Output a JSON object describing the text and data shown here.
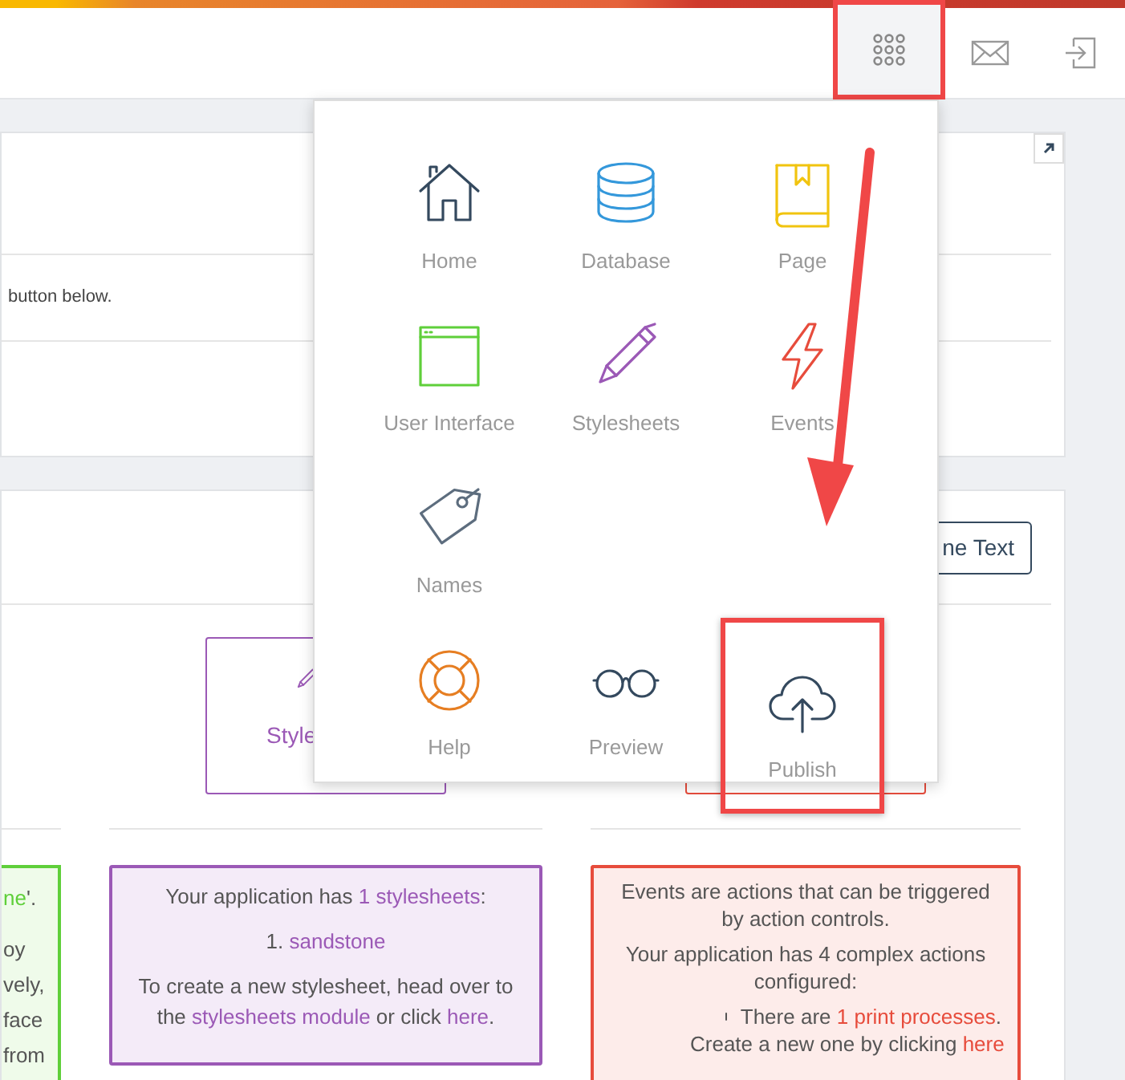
{
  "header": {
    "apps_button": {
      "highlighted": true
    }
  },
  "card_top": {
    "text": "button below."
  },
  "card_main": {
    "toggle_button": "ne Text",
    "stylesheets_button": "Style",
    "green_box": {
      "lines": [
        [
          {
            "kind": "link",
            "text": "ne"
          },
          {
            "kind": "text",
            "text": "'."
          }
        ],
        [
          {
            "kind": "text",
            "text": "oy"
          }
        ],
        [
          {
            "kind": "text",
            "text": "vely,"
          }
        ],
        [
          {
            "kind": "text",
            "text": "face"
          }
        ],
        [
          {
            "kind": "text",
            "text": "from"
          }
        ]
      ]
    },
    "purple_box": {
      "paragraphs": [
        [
          {
            "kind": "text",
            "text": "Your application has "
          },
          {
            "kind": "link",
            "text": "1 stylesheets"
          },
          {
            "kind": "text",
            "text": ":"
          }
        ],
        [
          {
            "kind": "text",
            "text": "1. "
          },
          {
            "kind": "link",
            "text": "sandstone"
          }
        ],
        [
          {
            "kind": "text",
            "text": "To create a new stylesheet, head over to the "
          },
          {
            "kind": "link",
            "text": "stylesheets module"
          },
          {
            "kind": "text",
            "text": " or click "
          },
          {
            "kind": "link",
            "text": "here"
          },
          {
            "kind": "text",
            "text": "."
          }
        ]
      ]
    },
    "red_box": {
      "paragraphs": [
        [
          {
            "kind": "text",
            "text": "Events are actions that can be triggered by action controls."
          }
        ],
        [
          {
            "kind": "text",
            "text": "Your application has 4 complex actions configured:"
          }
        ]
      ],
      "bullets": [
        [
          {
            "kind": "text",
            "text": "There are "
          },
          {
            "kind": "link",
            "text": "1 print processes"
          },
          {
            "kind": "text",
            "text": "."
          }
        ]
      ],
      "after": [
        {
          "kind": "text",
          "text": "Create a new one by clicking "
        },
        {
          "kind": "link",
          "text": "here"
        }
      ]
    }
  },
  "apps_menu": {
    "rows": [
      [
        {
          "label": "Home",
          "highlighted": false
        },
        {
          "label": "Database",
          "highlighted": false
        },
        {
          "label": "Page",
          "highlighted": false
        }
      ],
      [
        {
          "label": "User Interface",
          "highlighted": false
        },
        {
          "label": "Stylesheets",
          "highlighted": false
        },
        {
          "label": "Events",
          "highlighted": false
        }
      ],
      [
        {
          "label": "Names",
          "highlighted": false
        }
      ],
      [
        {
          "label": "Help",
          "highlighted": false
        },
        {
          "label": "Preview",
          "highlighted": false
        },
        {
          "label": "Publish",
          "highlighted": true
        }
      ]
    ]
  }
}
